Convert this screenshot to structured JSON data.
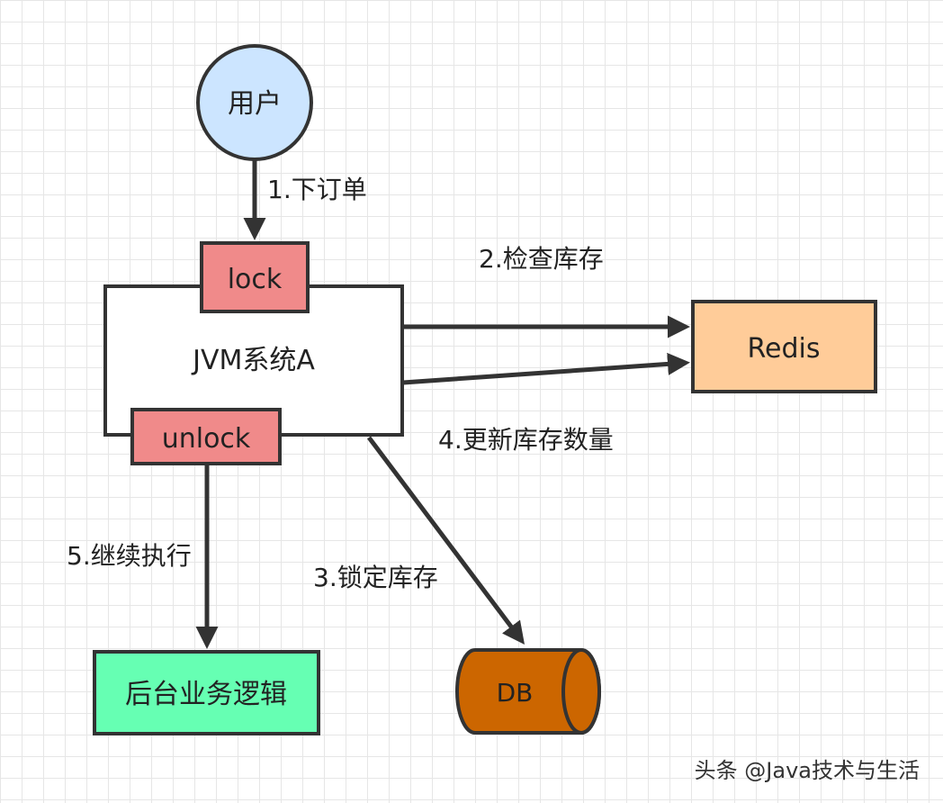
{
  "nodes": {
    "user": {
      "label": "用户",
      "fill": "#cce5ff"
    },
    "lock": {
      "label": "lock",
      "fill": "#f08a8a"
    },
    "unlock": {
      "label": "unlock",
      "fill": "#f08a8a"
    },
    "jvm": {
      "label": "JVM系统A",
      "fill": "#ffffff"
    },
    "redis": {
      "label": "Redis",
      "fill": "#ffcc99"
    },
    "db": {
      "label": "DB",
      "fill": "#cc6600"
    },
    "backend": {
      "label": "后台业务逻辑",
      "fill": "#66ffb3"
    }
  },
  "edges": {
    "place_order": "1.下订单",
    "check_stock": "2.检查库存",
    "lock_stock": "3.锁定库存",
    "update_stock": "4.更新库存数量",
    "continue_exec": "5.继续执行"
  },
  "watermark": "头条 @Java技术与生活"
}
